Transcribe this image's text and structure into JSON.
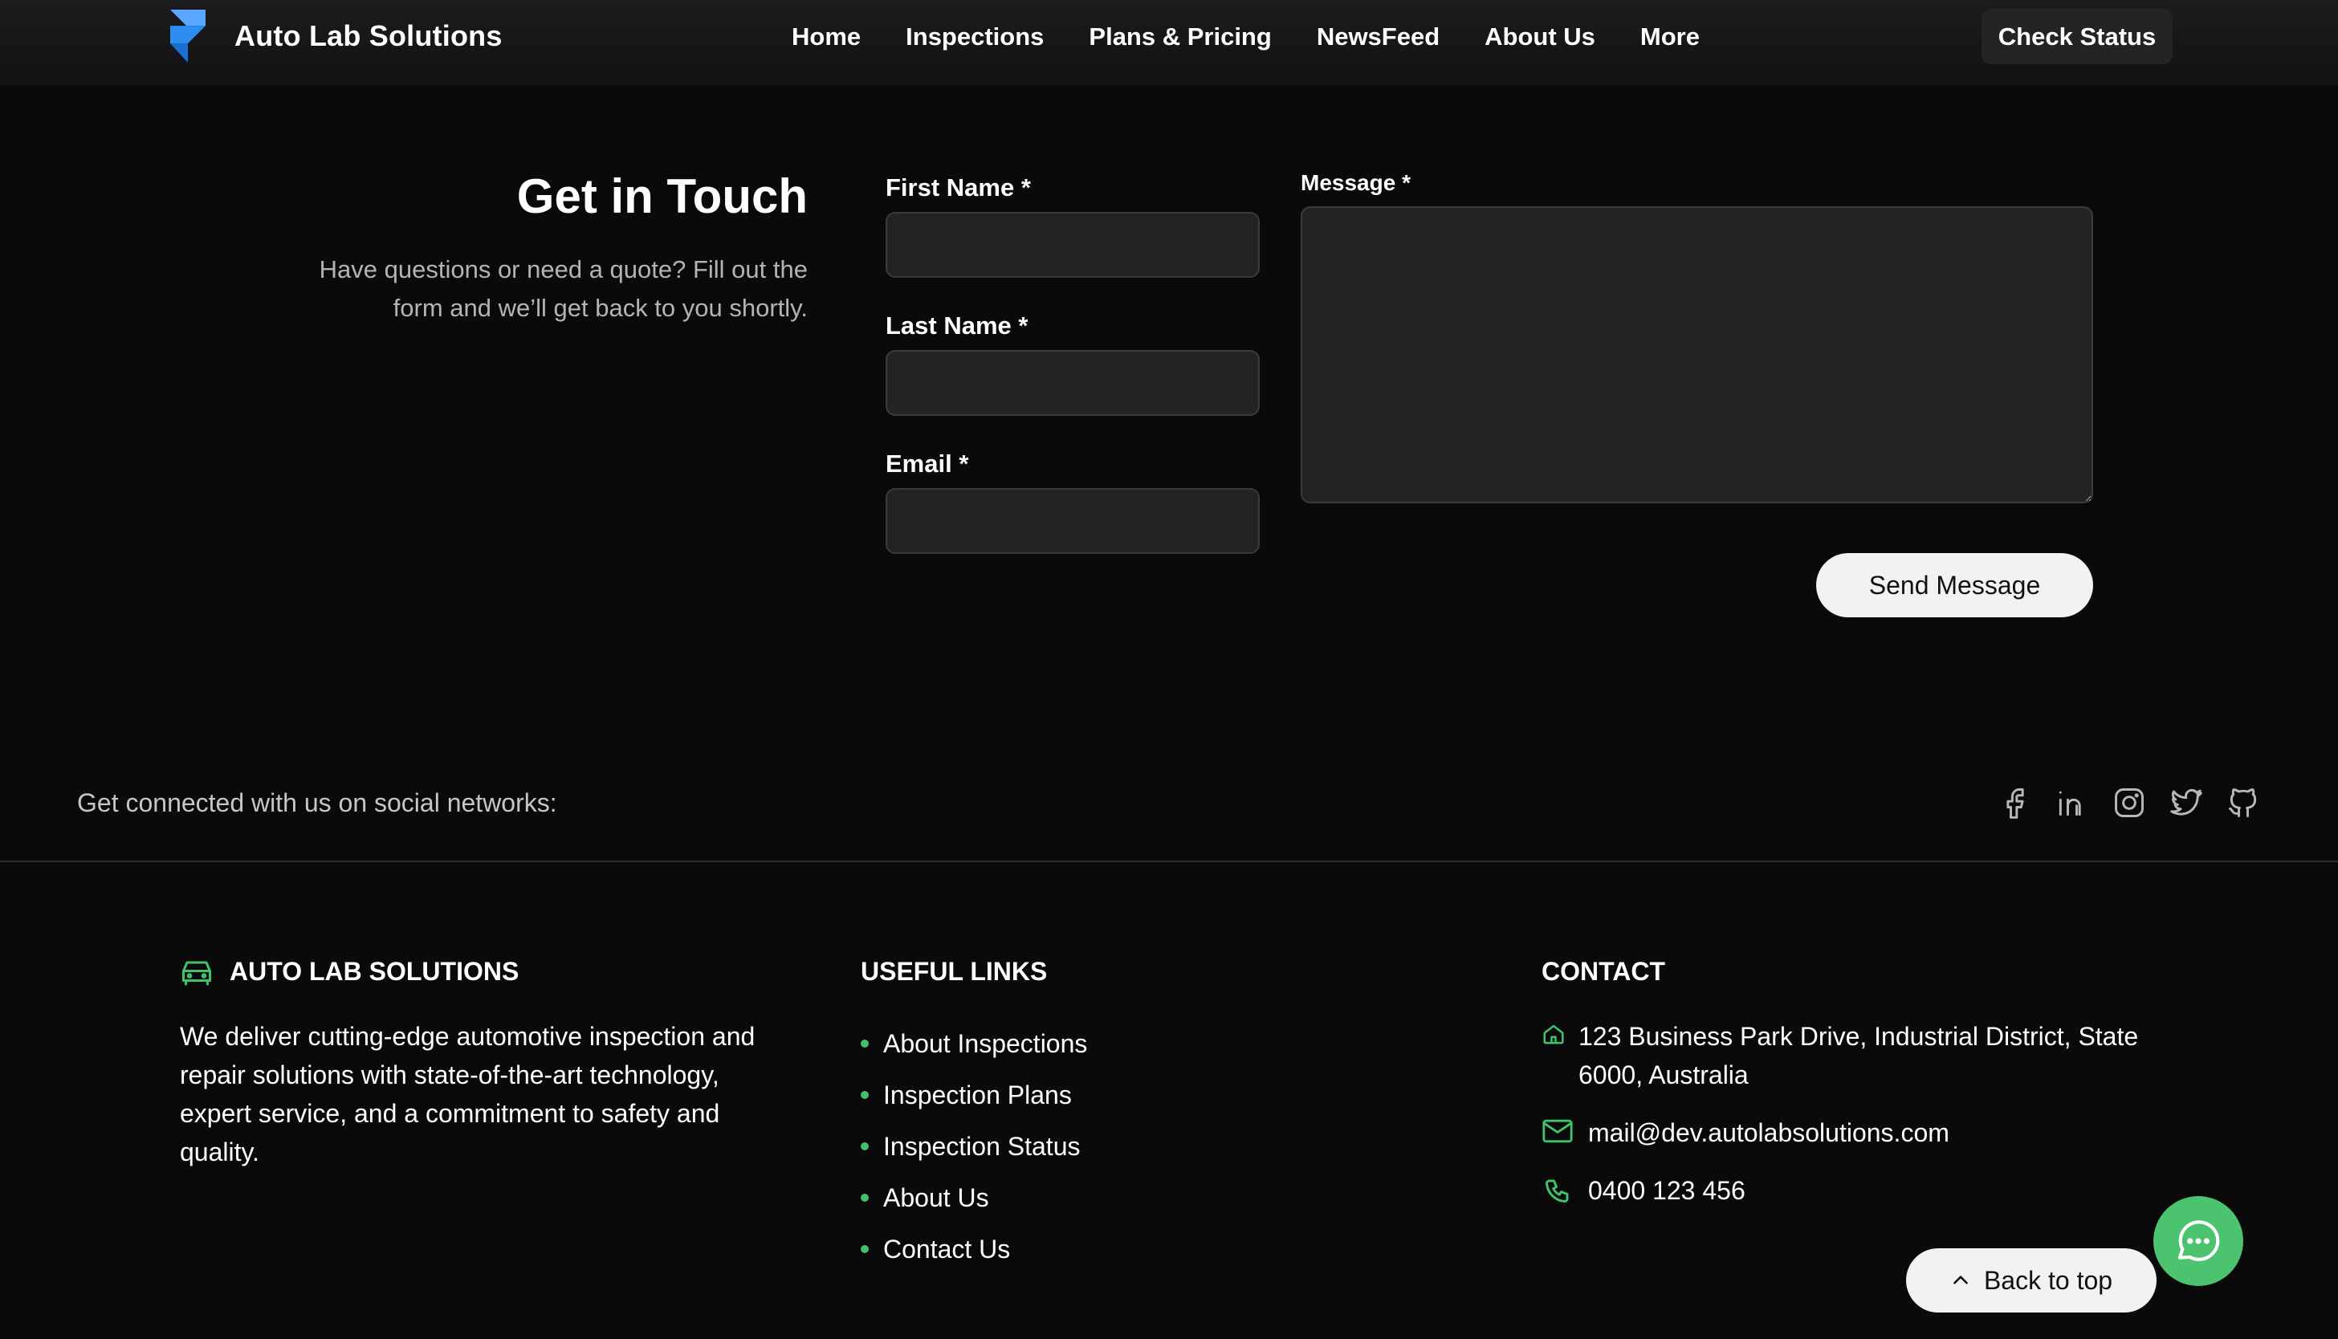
{
  "navbar": {
    "brand": "Auto Lab Solutions",
    "links": [
      {
        "label": "Home"
      },
      {
        "label": "Inspections"
      },
      {
        "label": "Plans & Pricing"
      },
      {
        "label": "NewsFeed"
      },
      {
        "label": "About Us"
      },
      {
        "label": "More"
      }
    ],
    "cta": "Check Status"
  },
  "contact_form": {
    "title": "Get in Touch",
    "description": "Have questions or need a quote? Fill out the form and we’ll get back to you shortly.",
    "first_name_label": "First Name *",
    "first_name_value": "",
    "last_name_label": "Last Name *",
    "last_name_value": "",
    "email_label": "Email *",
    "email_value": "",
    "message_label": "Message *",
    "message_value": "",
    "submit_label": "Send Message"
  },
  "social": {
    "text": "Get connected with us on social networks:",
    "icons": [
      "facebook-icon",
      "linkedin-icon",
      "instagram-icon",
      "twitter-icon",
      "github-icon"
    ]
  },
  "footer": {
    "about": {
      "title": "AUTO LAB SOLUTIONS",
      "icon": "car-icon",
      "description": "We deliver cutting-edge automotive inspection and repair solutions with state-of-the-art technology, expert service, and a commitment to safety and quality."
    },
    "links": {
      "title": "USEFUL LINKS",
      "items": [
        {
          "label": "About Inspections"
        },
        {
          "label": "Inspection Plans"
        },
        {
          "label": "Inspection Status"
        },
        {
          "label": "About Us"
        },
        {
          "label": "Contact Us"
        }
      ]
    },
    "contact": {
      "title": "CONTACT",
      "address": "123 Business Park Drive, Industrial District, State 6000, Australia",
      "email": "mail@dev.autolabsolutions.com",
      "phone": "0400 123 456"
    }
  },
  "back_to_top": "Back to top",
  "colors": {
    "accent_green": "#3fc26a",
    "chat_button": "#4cc36f",
    "logo_blue": "#2f8cf0",
    "background": "#0a0a0b"
  }
}
